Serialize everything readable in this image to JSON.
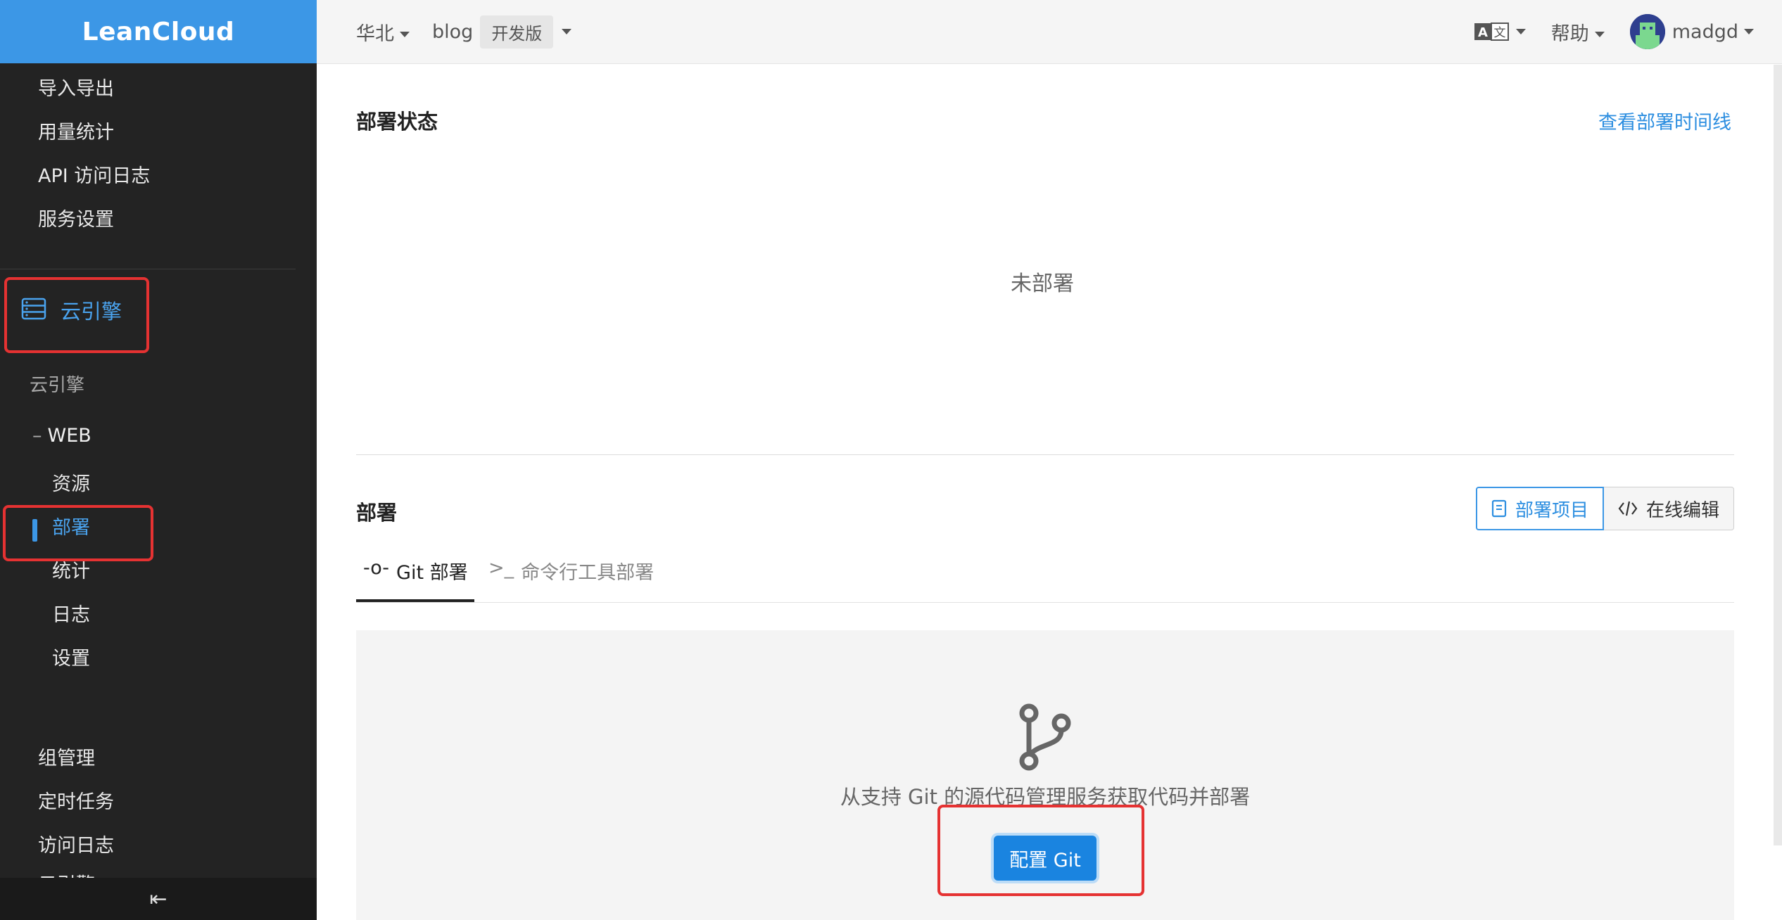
{
  "brand": {
    "logo": "LeanCloud"
  },
  "sidebar": {
    "items_top": [
      {
        "label": "导入导出"
      },
      {
        "label": "用量统计"
      },
      {
        "label": "API 访问日志"
      },
      {
        "label": "服务设置"
      }
    ],
    "section": {
      "label": "云引擎",
      "icon": "server-icon"
    },
    "group_label": "云引擎",
    "web": {
      "prefix": "–",
      "label": "WEB"
    },
    "web_items": [
      {
        "label": "资源",
        "active": false
      },
      {
        "label": "部署",
        "active": true
      },
      {
        "label": "统计",
        "active": false
      },
      {
        "label": "日志",
        "active": false
      },
      {
        "label": "设置",
        "active": false
      }
    ],
    "items_bottom": [
      {
        "label": "组管理"
      },
      {
        "label": "定时任务"
      },
      {
        "label": "访问日志"
      },
      {
        "label": "云引擎"
      }
    ],
    "collapse_icon": "⇤"
  },
  "topbar": {
    "region": "华北",
    "app": "blog",
    "env": "开发版",
    "language_icon": "translate-icon",
    "help": "帮助",
    "user": "madgd"
  },
  "status_section": {
    "title": "部署状态",
    "timeline_link": "查看部署时间线",
    "empty_text": "未部署"
  },
  "deploy_section": {
    "title": "部署",
    "buttons": [
      {
        "label": "部署项目",
        "icon": "book-icon"
      },
      {
        "label": "在线编辑",
        "icon": "code-icon"
      }
    ],
    "tabs": [
      {
        "label": "Git 部署",
        "icon": "-o-",
        "active": true
      },
      {
        "label": "命令行工具部署",
        "icon": ">_",
        "active": false
      }
    ],
    "panel": {
      "description": "从支持 Git 的源代码管理服务获取代码并部署",
      "button": "配置 Git"
    }
  },
  "colors": {
    "accent": "#3c97e6",
    "sidebar_bg": "#232323",
    "annotation": "#e53232"
  }
}
